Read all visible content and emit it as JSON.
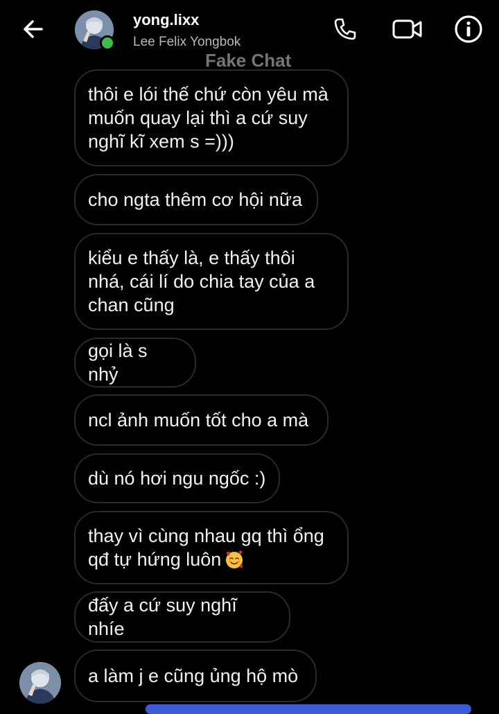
{
  "header": {
    "username": "yong.lixx",
    "full_name": "Lee Felix Yongbok",
    "watermark": "Fake Chat",
    "icons": {
      "back": "arrow-left-icon",
      "call": "phone-icon",
      "video": "video-camera-icon",
      "info": "info-icon"
    },
    "online_color": "#3fbf4a"
  },
  "messages": [
    {
      "text": "thôi e lói thế chứ còn yêu mà\nmuốn quay lại thì a cứ suy\nnghĩ kĩ xem s =)))"
    },
    {
      "text": "cho ngta thêm cơ hội nữa"
    },
    {
      "text": "kiểu e thấy là, e thấy thôi\nnhá, cái lí do chia tay của a\nchan cũng"
    },
    {
      "text": "gọi là s nhỷ"
    },
    {
      "text": "ncl ảnh muốn tốt cho a mà"
    },
    {
      "text": "dù nó hơi ngu ngốc :)"
    },
    {
      "text": "thay vì cùng nhau gq thì ổng\nqđ tự hứng luôn",
      "emoji": "smiling-face-with-hearts"
    },
    {
      "text": "đấy a cứ suy nghĩ nhíe"
    },
    {
      "text": "a làm j e cũng ủng hộ mò"
    }
  ],
  "colors": {
    "background": "#000000",
    "bubble_border": "#2a2a2a",
    "compose_accent": "#3b5bd9"
  }
}
